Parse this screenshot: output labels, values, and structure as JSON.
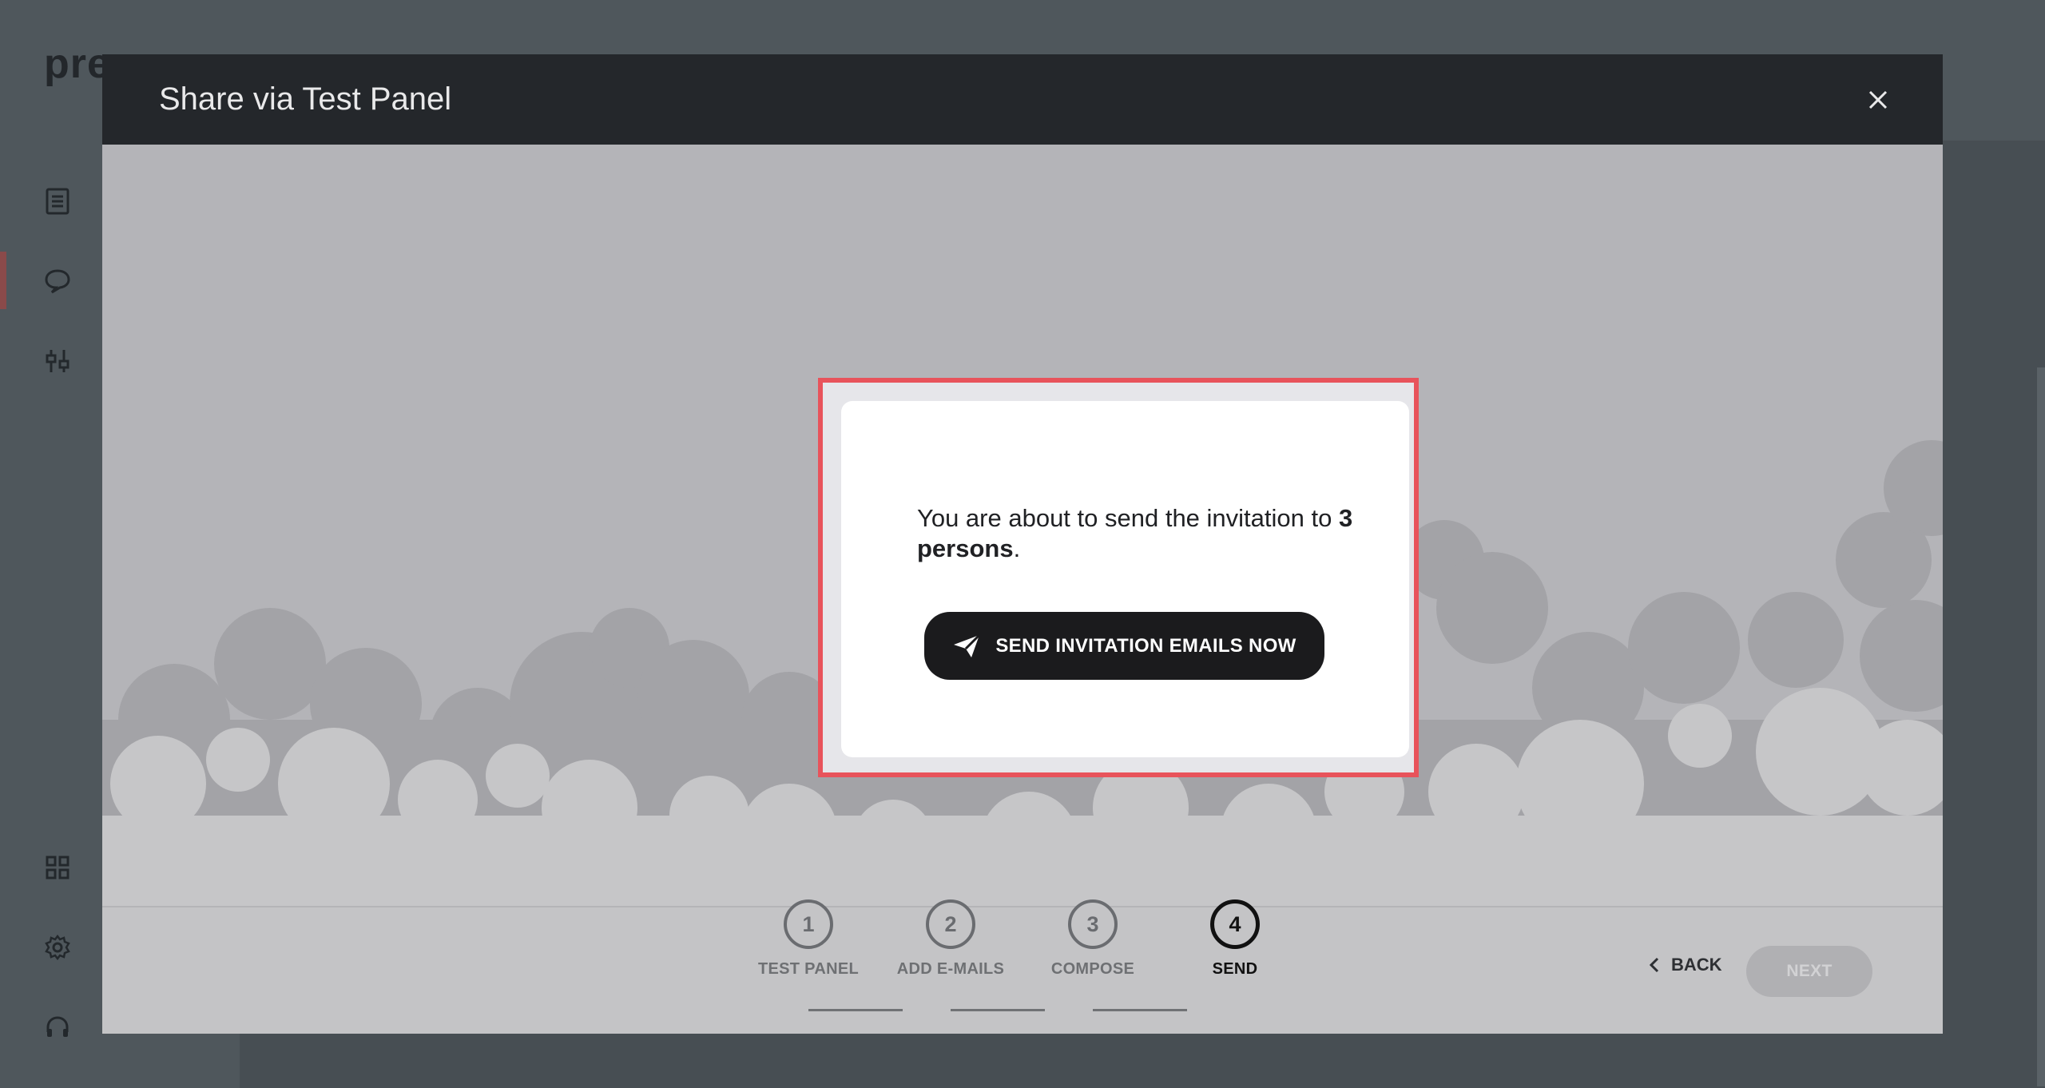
{
  "app": {
    "logo": "pre",
    "icons": [
      "document-icon",
      "chat-icon",
      "sliders-icon",
      "grid-icon",
      "gear-icon",
      "headset-icon"
    ]
  },
  "modal": {
    "title": "Share via Test Panel",
    "close_icon": "close-icon"
  },
  "card": {
    "message_prefix": "You are about to send the invitation to ",
    "message_bold": "3 persons",
    "message_suffix": ".",
    "send_button": "SEND INVITATION EMAILS NOW",
    "send_icon": "paper-plane-icon",
    "highlight_color": "#e8535b"
  },
  "stepper": {
    "current_step": 4,
    "steps": [
      {
        "number": "1",
        "label": "TEST PANEL"
      },
      {
        "number": "2",
        "label": "ADD E-MAILS"
      },
      {
        "number": "3",
        "label": "COMPOSE"
      },
      {
        "number": "4",
        "label": "SEND"
      }
    ]
  },
  "footer": {
    "back_label": "BACK",
    "next_label": "NEXT"
  }
}
